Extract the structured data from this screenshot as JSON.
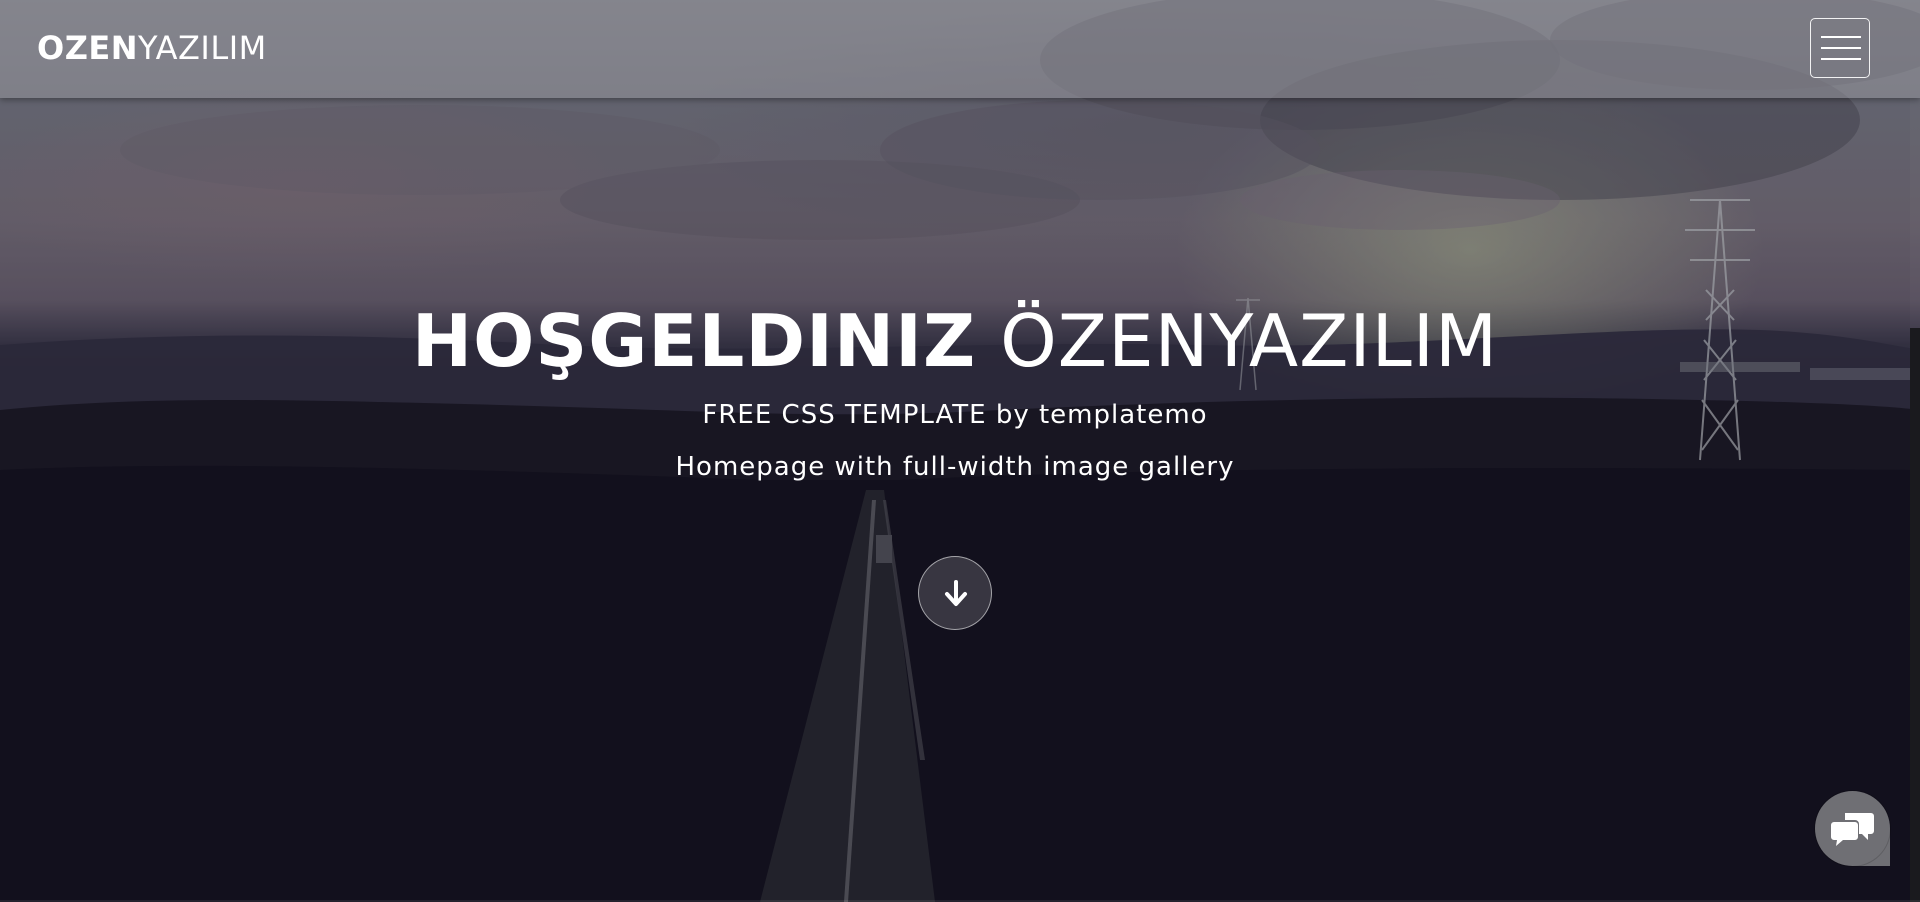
{
  "navbar": {
    "brand_bold": "OZEN",
    "brand_light": "YAZILIM",
    "menu_icon": "hamburger-icon"
  },
  "hero": {
    "title_strong": "HOŞGELDINIZ",
    "title_thin": "ÖZENYAZILIM",
    "subtitle_line1": "FREE CSS TEMPLATE by templatemo",
    "subtitle_line2": "Homepage with full-width image gallery",
    "scroll_icon": "arrow-down-icon"
  },
  "chat": {
    "icon": "chat-bubbles-icon"
  },
  "colors": {
    "text": "#ffffff",
    "navbar_bg": "#96969c",
    "chat_bg": "#6f6f74"
  }
}
